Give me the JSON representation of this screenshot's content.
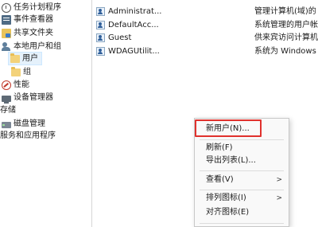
{
  "tree": {
    "items": [
      {
        "label": "任务计划程序",
        "icon": "clock-icon"
      },
      {
        "label": "事件查看器",
        "icon": "event-viewer-icon"
      },
      {
        "label": "共享文件夹",
        "icon": "shared-folder-icon"
      },
      {
        "label": "本地用户和组",
        "icon": "users-icon"
      },
      {
        "label": "用户",
        "icon": "folder-icon",
        "selected": true
      },
      {
        "label": "组",
        "icon": "folder-icon"
      },
      {
        "label": "性能",
        "icon": "performance-icon"
      },
      {
        "label": "设备管理器",
        "icon": "device-manager-icon"
      },
      {
        "label": "存储"
      },
      {
        "label": "磁盘管理",
        "icon": "disk-icon"
      },
      {
        "label": "服务和应用程序"
      }
    ]
  },
  "users": [
    {
      "name": "Administrat...",
      "description": "管理计算机(域)的"
    },
    {
      "name": "DefaultAcc...",
      "description": "系统管理的用户帐"
    },
    {
      "name": "Guest",
      "description": "供来宾访问计算机"
    },
    {
      "name": "WDAGUtilit...",
      "description": "系统为 Windows"
    }
  ],
  "context_menu": {
    "items": [
      {
        "label": "新用户(N)...",
        "highlighted": true
      },
      {
        "label": "刷新(F)"
      },
      {
        "label": "导出列表(L)..."
      },
      {
        "label": "查看(V)",
        "submenu": true
      },
      {
        "label": "排列图标(I)",
        "submenu": true
      },
      {
        "label": "对齐图标(E)"
      }
    ],
    "submenu_arrow": ">"
  },
  "colors": {
    "highlight_border": "#e0312d",
    "selection_bg": "#e5f1fb"
  }
}
